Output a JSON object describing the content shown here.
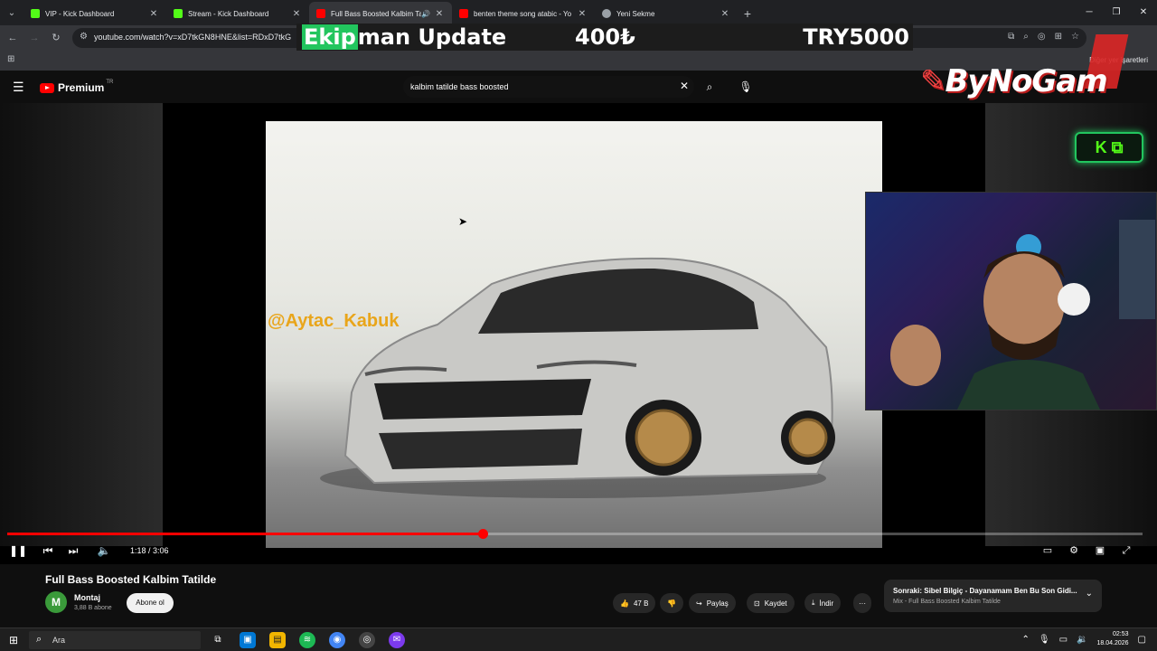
{
  "browser": {
    "tabs": [
      {
        "title": "VIP - Kick Dashboard",
        "favicon_color": "#53fc18",
        "active": false
      },
      {
        "title": "Stream - Kick Dashboard",
        "favicon_color": "#53fc18",
        "active": false
      },
      {
        "title": "Full Bass Boosted Kalbim Ta",
        "favicon_color": "#ff0000",
        "active": true
      },
      {
        "title": "benten theme song atabic - Yo",
        "favicon_color": "#ff0000",
        "active": false
      },
      {
        "title": "Yeni Sekme",
        "favicon_color": "#9aa0a6",
        "active": false
      }
    ],
    "url": "youtube.com/watch?v=xD7tkGN8HNE&list=RDxD7tkG",
    "bookmarks_other": "Diğer yer işaretleri"
  },
  "overlay": {
    "ekipman_label_prefix": "Ekip",
    "ekipman_label_rest": "man Update",
    "amount_1": "400₺",
    "amount_2": "TRY5000",
    "brand": "ByNoGam",
    "kick_badge": "K ⧉"
  },
  "youtube": {
    "logo_text": "Premium",
    "country": "TR",
    "search_query": "kalbim tatilde bass boosted",
    "player": {
      "watermark": "@Aytac_Kabuk",
      "current_time": "1:18 / 3:06",
      "progress_fraction": 0.419
    },
    "video": {
      "title": "Full Bass Boosted Kalbim Tatilde",
      "channel": "Montaj",
      "channel_initial": "M",
      "subscribers": "3,88 B abone",
      "subscribe_label": "Abone ol",
      "likes": "47 B",
      "share_label": "Paylaş",
      "save_label": "Kaydet",
      "download_label": "İndir",
      "more_label": "···"
    },
    "next_card": {
      "title": "Sonraki: Sibel Bilgiç - Dayanamam Ben Bu Son Gidi...",
      "subtitle": "Mix - Full Bass Boosted Kalbim Tatilde"
    }
  },
  "taskbar": {
    "search_placeholder": "Ara",
    "time": "02:53",
    "date": "18.04.2026"
  }
}
